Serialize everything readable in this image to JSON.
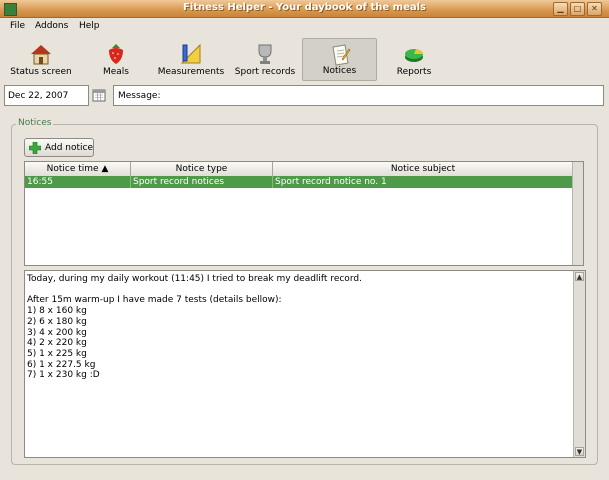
{
  "window": {
    "title": "Fitness Helper - Your daybook of the meals"
  },
  "menu": {
    "items": [
      "File",
      "Addons",
      "Help"
    ]
  },
  "toolbar": {
    "buttons": [
      {
        "label": "Status screen",
        "icon": "house-icon"
      },
      {
        "label": "Meals",
        "icon": "strawberry-icon"
      },
      {
        "label": "Measurements",
        "icon": "ruler-pencil-icon"
      },
      {
        "label": "Sport records",
        "icon": "trophy-icon"
      },
      {
        "label": "Notices",
        "icon": "notepad-icon",
        "active": true
      },
      {
        "label": "Reports",
        "icon": "pie-chart-icon"
      }
    ]
  },
  "date": {
    "value": "Dec 22, 2007"
  },
  "message": {
    "label": "Message:"
  },
  "notices": {
    "group_title": "Notices",
    "add_button": "Add notice",
    "columns": [
      "Notice time",
      "Notice type",
      "Notice subject"
    ],
    "rows": [
      {
        "time": "16:55",
        "type": "Sport record notices",
        "subject": "Sport record notice no. 1",
        "selected": true
      }
    ],
    "text": [
      "Today, during my daily workout (11:45) I tried to break my deadlift record.",
      "",
      "After 15m warm-up I have made 7 tests (details bellow):",
      "1) 8 x 160 kg",
      "2) 6 x 180 kg",
      "3) 4 x 200 kg",
      "4) 2 x 220 kg",
      "5) 1 x 225 kg",
      "6) 1 x 227.5 kg",
      "7) 1 x 230 kg :D"
    ]
  },
  "colors": {
    "titlebar": "#d89850",
    "selection": "#4e9a48",
    "group_legend": "#4a7a4a"
  }
}
